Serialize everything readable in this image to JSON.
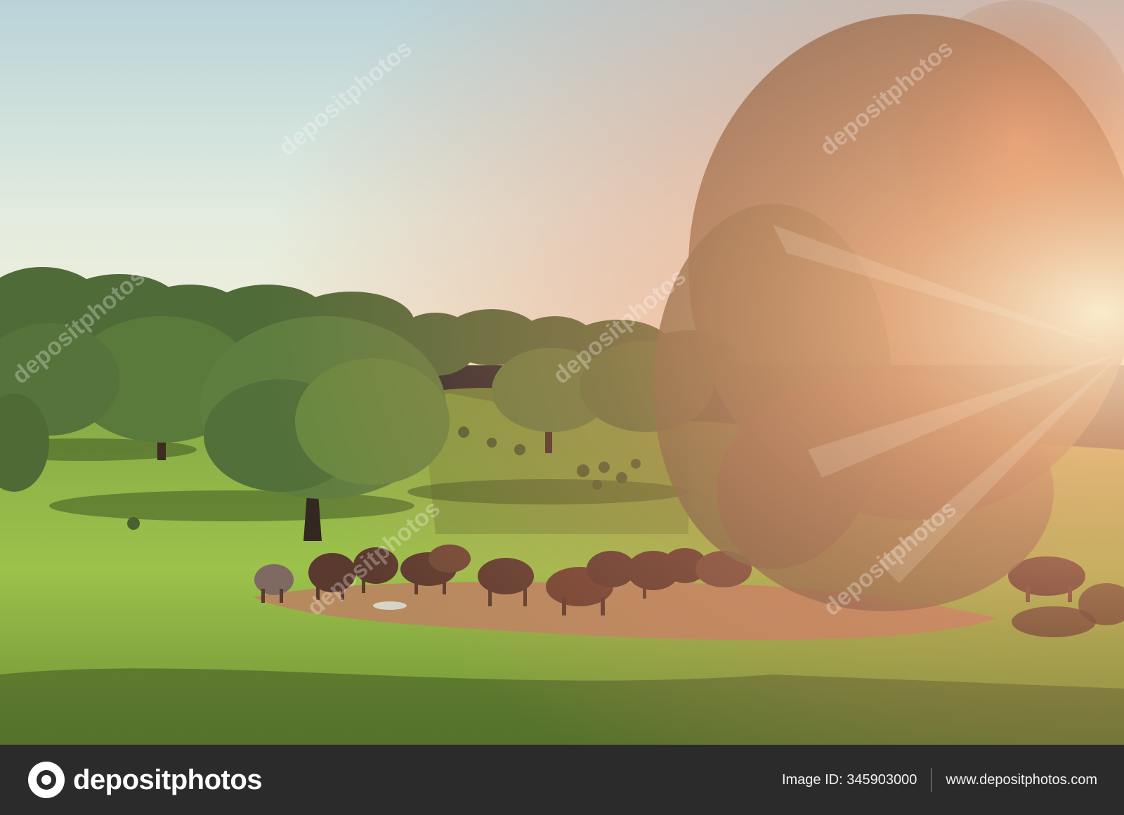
{
  "photo": {
    "subject": "herd of pigs grazing in a sunlit oak pasture",
    "watermark": "depositphotos",
    "colors": {
      "sky_top": "#b9d3d8",
      "sky_bottom": "#eef0df",
      "grass": "#8fb545",
      "flare": "#ffb27a"
    }
  },
  "footer": {
    "logo_text": "depositphotos",
    "image_id": "Image ID: 345903000",
    "site": "www.depositphotos.com",
    "bg_color": "#2b2b2b"
  }
}
